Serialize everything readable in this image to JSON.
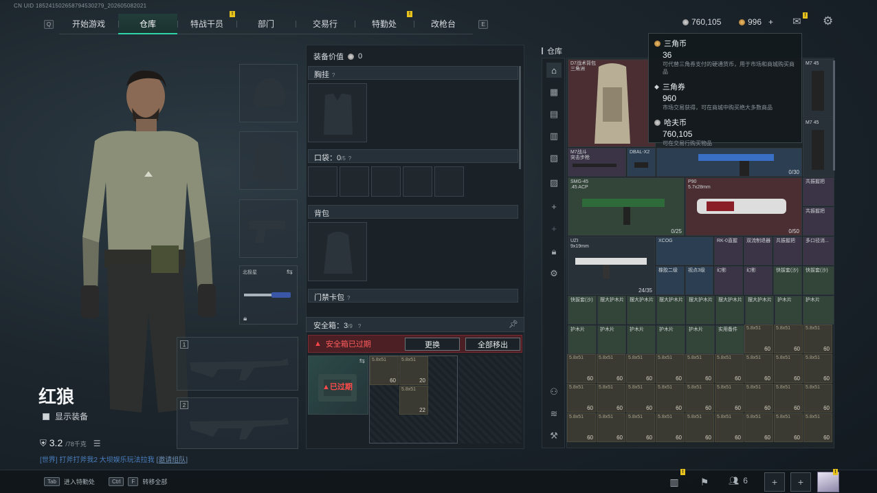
{
  "uid": "CN UID 185241502658794530279_202605082021",
  "nav": {
    "left_key": "Q",
    "right_key": "E",
    "tabs": [
      {
        "label": "开始游戏"
      },
      {
        "label": "仓库"
      },
      {
        "label": "特战干员"
      },
      {
        "label": "部门"
      },
      {
        "label": "交易行"
      },
      {
        "label": "特勤处"
      },
      {
        "label": "改枪台"
      }
    ],
    "badge": "!"
  },
  "currency": {
    "havoc": "760,105",
    "triangle": "996",
    "plus": "+"
  },
  "character": {
    "name": "红狼",
    "show_equipment": "显示装备",
    "weight": "3.2",
    "weight_max": "/78千克"
  },
  "chat": {
    "text": "[世界] 打斧打斧我2  大坝娱乐玩法拉我 ",
    "join": "[邀请组队]"
  },
  "slots": {
    "melee_label": "北极星",
    "w1": "1",
    "w2": "2"
  },
  "equipment": {
    "value_label": "装备价值",
    "value": "0",
    "chest": "胸挂",
    "pocket": "口袋：",
    "pocket_count": "0",
    "pocket_max": "/5",
    "backpack": "背包",
    "keycard": "门禁卡包",
    "q": "?"
  },
  "safe": {
    "label": "安全箱：",
    "count": "3",
    "max": "/9",
    "expired_warning": "安全箱已过期",
    "replace": "更换",
    "move_all": "全部移出",
    "expired_tag": "已过期",
    "items": [
      {
        "t": "5.8x51",
        "n": "60"
      },
      {
        "t": "5.8x51",
        "n": "20"
      },
      {
        "t": "5.8x51",
        "n": "22"
      }
    ]
  },
  "warehouse": {
    "title": "仓库",
    "items": [
      {
        "nm": "D7战术背包\n三角洲",
        "cnt": ""
      },
      {
        "nm": "M7战斗\n突击步枪",
        "cnt": ""
      },
      {
        "nm": "DBAL-X2",
        "cnt": ""
      },
      {
        "nm": "",
        "cnt": "0/30"
      },
      {
        "nm": "M7 45",
        "cnt": ""
      },
      {
        "nm": "M7 45",
        "cnt": ""
      },
      {
        "nm": "SMG-45\n.45 ACP",
        "cnt": "0/25"
      },
      {
        "nm": "P90\n5.7x28mm",
        "cnt": "0/50"
      },
      {
        "nm": "共振握把",
        "cnt": ""
      },
      {
        "nm": "共振握把",
        "cnt": ""
      },
      {
        "nm": "UZI\n9x19mm",
        "cnt": "24/35"
      },
      {
        "nm": "XCOG",
        "cnt": ""
      },
      {
        "nm": "RK-0直握",
        "cnt": ""
      },
      {
        "nm": "双流制退器",
        "cnt": ""
      },
      {
        "nm": "共振握把",
        "cnt": ""
      },
      {
        "nm": "多口径消...",
        "cnt": ""
      },
      {
        "nm": "橡胶二级",
        "cnt": ""
      },
      {
        "nm": "视点3级",
        "cnt": ""
      },
      {
        "nm": "幻影",
        "cnt": ""
      },
      {
        "nm": "幻影",
        "cnt": ""
      },
      {
        "nm": "快拔套(沙)",
        "cnt": ""
      },
      {
        "nm": "快拔套(沙)",
        "cnt": ""
      },
      {
        "nm": "快拔套(沙)",
        "cnt": ""
      },
      {
        "nm": "摆大护木片",
        "cnt": ""
      },
      {
        "nm": "摆大护木片",
        "cnt": ""
      },
      {
        "nm": "摆大护木片",
        "cnt": ""
      },
      {
        "nm": "摆大护木片",
        "cnt": ""
      },
      {
        "nm": "摆大护木片",
        "cnt": ""
      },
      {
        "nm": "摆大护木片",
        "cnt": ""
      },
      {
        "nm": "护木片",
        "cnt": ""
      },
      {
        "nm": "护木片",
        "cnt": ""
      },
      {
        "nm": "护木片",
        "cnt": ""
      },
      {
        "nm": "护木片",
        "cnt": ""
      },
      {
        "nm": "护木片",
        "cnt": ""
      },
      {
        "nm": "护木片",
        "cnt": ""
      },
      {
        "nm": "实用备件",
        "cnt": ""
      },
      {
        "nm": "5.8x51",
        "cnt": "60"
      }
    ],
    "ammo_type": "5.8x51",
    "ammo_count": "60"
  },
  "tooltip": {
    "items": [
      {
        "name": "三角币",
        "value": "36",
        "desc": "可代替三角券支付的硬通货币，用于市场和商城购买商品"
      },
      {
        "name": "三角券",
        "value": "960",
        "desc": "市场交易获得，可在商城中购买绝大多数商品"
      },
      {
        "name": "哈夫币",
        "value": "760,105",
        "desc": "可在交易行购买物品"
      }
    ]
  },
  "bottom": {
    "tab_key": "Tab",
    "tab_label": "进入特勤处",
    "ctrl_key": "Ctrl",
    "f_key": "F",
    "ctrl_label": "转移全部",
    "friends": "6",
    "plus": "+"
  },
  "colors": {
    "accent": "#2fd5a8",
    "warning": "#ff4a4a",
    "badge": "#e8c21c"
  }
}
